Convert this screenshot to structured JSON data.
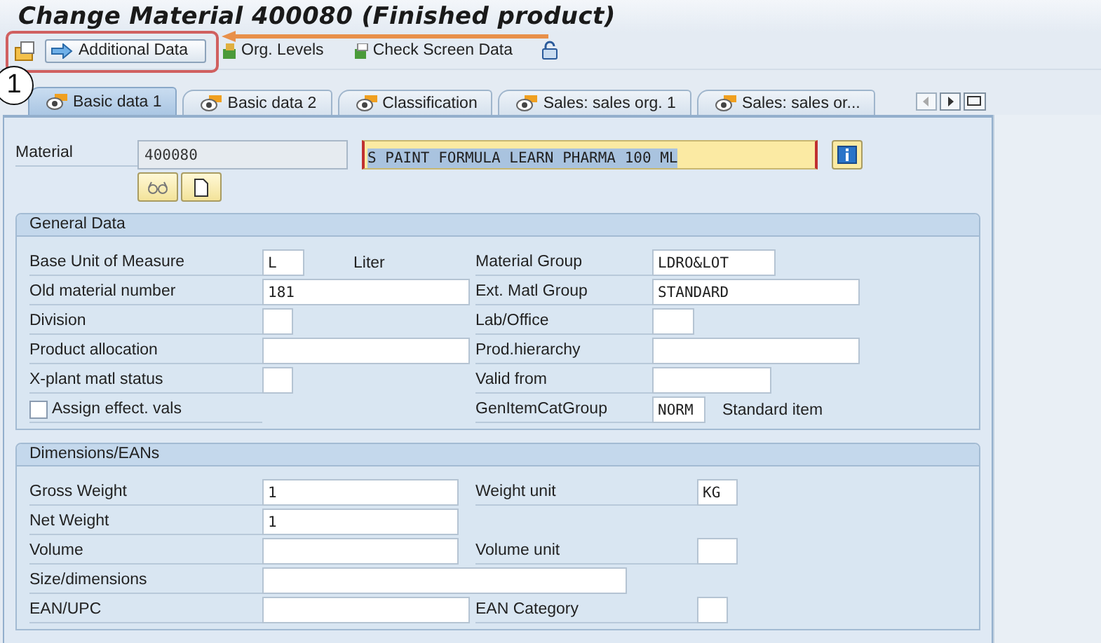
{
  "window": {
    "title": "Change Material 400080 (Finished product)"
  },
  "toolbar": {
    "buttons": [
      {
        "label": "Additional Data"
      },
      {
        "label": "Org. Levels"
      },
      {
        "label": "Check Screen Data"
      }
    ]
  },
  "annotation": {
    "step": "1"
  },
  "tabs": [
    {
      "label": "Basic data 1",
      "selected": true
    },
    {
      "label": "Basic data 2",
      "selected": false
    },
    {
      "label": "Classification",
      "selected": false
    },
    {
      "label": "Sales: sales org. 1",
      "selected": false
    },
    {
      "label": "Sales: sales or...",
      "selected": false
    }
  ],
  "material": {
    "label": "Material",
    "number": "400080",
    "description": "S PAINT FORMULA LEARN PHARMA 100 ML"
  },
  "groups": [
    {
      "title": "General Data",
      "rows": [
        {
          "kind": "field",
          "label": "Base Unit of Measure",
          "value": "L",
          "note": "Liter",
          "right": {
            "label": "Material Group",
            "value": "LDRO&LOT"
          }
        },
        {
          "kind": "field",
          "label": "Old material number",
          "value": "181",
          "right": {
            "label": "Ext. Matl Group",
            "value": "STANDARD"
          }
        },
        {
          "kind": "field",
          "label": "Division",
          "right": {
            "label": "Lab/Office"
          }
        },
        {
          "kind": "field",
          "label": "Product allocation",
          "right": {
            "label": "Prod.hierarchy"
          }
        },
        {
          "kind": "field",
          "label": "X-plant matl status",
          "right": {
            "label": "Valid from"
          }
        },
        {
          "kind": "checkbox",
          "label": "Assign effect. vals",
          "checked": false,
          "right": {
            "label": "GenItemCatGroup",
            "value": "NORM",
            "note": "Standard item"
          }
        }
      ]
    },
    {
      "title": "Dimensions/EANs",
      "rows": [
        {
          "kind": "field",
          "label": "Gross Weight",
          "value": "1",
          "right": {
            "label": "Weight unit",
            "value": "KG"
          }
        },
        {
          "kind": "field",
          "label": "Net Weight",
          "value": "1"
        },
        {
          "kind": "field",
          "label": "Volume",
          "right": {
            "label": "Volume unit"
          }
        },
        {
          "kind": "field",
          "label": "Size/dimensions"
        },
        {
          "kind": "field",
          "label": "EAN/UPC",
          "right": {
            "label": "EAN Category"
          }
        }
      ]
    }
  ]
}
